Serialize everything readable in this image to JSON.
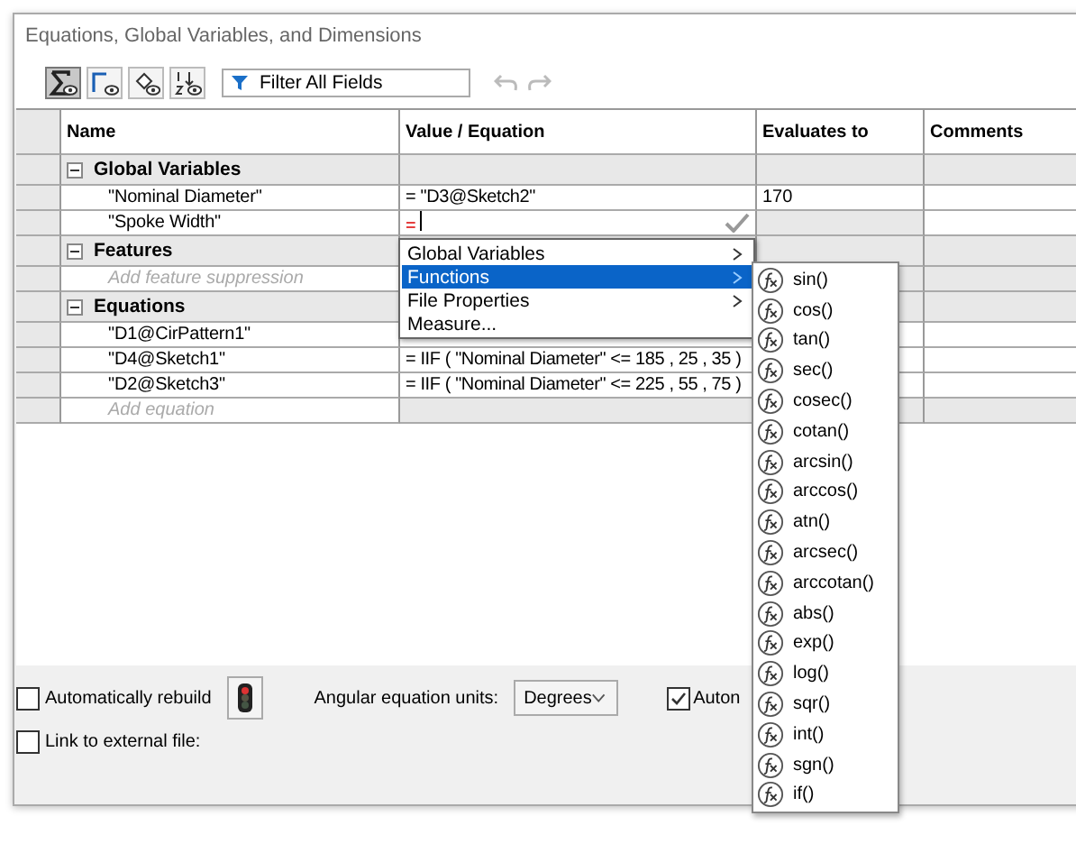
{
  "window": {
    "title": "Equations, Global Variables, and Dimensions"
  },
  "toolbar": {
    "view_buttons": [
      {
        "selected": true
      },
      {
        "selected": false
      },
      {
        "selected": false
      },
      {
        "selected": false
      }
    ],
    "filter": {
      "placeholder": "Filter All Fields"
    }
  },
  "table": {
    "columns": [
      "Name",
      "Value / Equation",
      "Evaluates to",
      "Comments"
    ],
    "sections": [
      {
        "title": "Global Variables",
        "expanded": true,
        "rows": [
          {
            "name": "\"Nominal Diameter\"",
            "value": "= \"D3@Sketch2\"",
            "evaluates": "170",
            "editing": false
          },
          {
            "name": "\"Spoke Width\"",
            "value": "=",
            "editing": true
          }
        ]
      },
      {
        "title": "Features",
        "expanded": true,
        "add_placeholder": "Add feature suppression"
      },
      {
        "title": "Equations",
        "expanded": true,
        "rows": [
          {
            "name": "\"D1@CirPattern1\"",
            "editing": false
          },
          {
            "name": "\"D4@Sketch1\"",
            "value": "= IIF ( \"Nominal Diameter\" <= 185 , 25 , 35 )",
            "editing": false
          },
          {
            "name": "\"D2@Sketch3\"",
            "value": "= IIF ( \"Nominal Diameter\" <= 225 , 55 , 75 )",
            "editing": false
          }
        ],
        "add_placeholder": "Add equation"
      }
    ]
  },
  "context_menu": {
    "items": [
      {
        "label": "Global Variables",
        "submenu": true,
        "selected": false
      },
      {
        "label": "Functions",
        "submenu": true,
        "selected": true
      },
      {
        "label": "File Properties",
        "submenu": true,
        "selected": false
      },
      {
        "label": "Measure...",
        "submenu": false,
        "selected": false
      }
    ]
  },
  "functions_menu": {
    "items": [
      "sin()",
      "cos()",
      "tan()",
      "sec()",
      "cosec()",
      "cotan()",
      "arcsin()",
      "arccos()",
      "atn()",
      "arcsec()",
      "arccotan()",
      "abs()",
      "exp()",
      "log()",
      "sqr()",
      "int()",
      "sgn()",
      "if()"
    ]
  },
  "footer": {
    "auto_rebuild": {
      "label": "Automatically rebuild",
      "checked": false
    },
    "units_label": "Angular equation units:",
    "units_value": "Degrees",
    "auto_option": {
      "label": "Auton",
      "checked": true
    },
    "link_external": {
      "label": "Link to external file:",
      "checked": false
    }
  }
}
